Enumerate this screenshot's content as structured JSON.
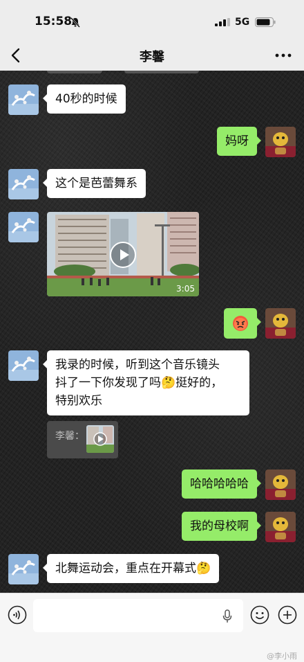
{
  "status_bar": {
    "time": "15:58",
    "network": "5G"
  },
  "nav": {
    "title": "李馨"
  },
  "messages": {
    "m1": "40秒的时候",
    "m2": "妈呀",
    "m3": "这个是芭蕾舞系",
    "video_duration": "3:05",
    "m5_line1": "我录的时候，听到这个音乐镜头",
    "m5_line2": "抖了一下你发现了吗🤔挺好的，",
    "m5_line3": "特别欢乐",
    "quote_name": "李馨：",
    "m6": "哈哈哈哈哈",
    "m7": "我的母校啊",
    "m8": "北舞运动会，重点在开幕式🤔"
  },
  "input": {
    "placeholder": ""
  },
  "watermark": "@李小雨",
  "colors": {
    "outgoing_bubble": "#95ec69",
    "incoming_bubble": "#ffffff",
    "bar": "#ededed"
  }
}
